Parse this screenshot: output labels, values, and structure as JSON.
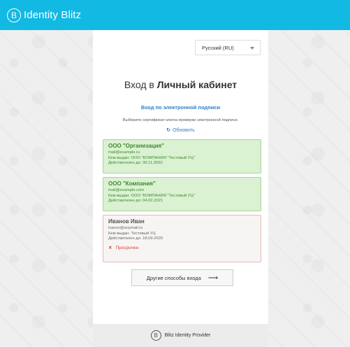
{
  "header": {
    "logo_glyph": "B",
    "brand": "Identity Blitz",
    "color": "#12b9e3"
  },
  "language": {
    "selected": "Русский (RU)"
  },
  "title": {
    "prefix": "Вход в ",
    "bold": "Личный кабинет"
  },
  "signature_link": "Вход по электронной подписи",
  "hint": "Выберите сертификат ключа проверки электронной подписи.",
  "refresh_label": "Обновить",
  "certificates": [
    {
      "name": "ООО \"Организация\"",
      "email": "mail@example.ru",
      "issuer": "Кем выдан: ООО \"КОМПАНИЯ \"Тестовый УЦ\"",
      "valid_until": "Действителен до: 30.11.2020",
      "state": "valid"
    },
    {
      "name": "ООО \"Компания\"",
      "email": "mail@example.com",
      "issuer": "Кем выдан: ООО \"КОМПАНИЯ \"Тестовый УЦ\"",
      "valid_until": "Действителен до: 04.02.2021",
      "state": "valid"
    },
    {
      "name": "Иванов Иван",
      "email": "ivanov@anymail.ru",
      "issuer": "Кем выдан: Тестовый УЦ",
      "valid_until": "Действителен до: 18.09.2020",
      "state": "expired",
      "status_label": "Просрочен"
    }
  ],
  "other_methods_label": "Другие способы входа",
  "footer": {
    "logo_glyph": "B",
    "label": "Blitz Identity Provider"
  },
  "colors": {
    "valid_bg": "#daf1d2",
    "expired_border": "#e9b7b7",
    "link": "#2f7fc7",
    "error": "#d9403a"
  }
}
